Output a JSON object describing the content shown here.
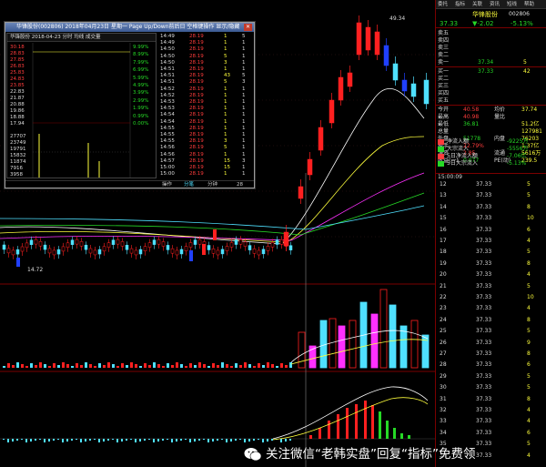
{
  "header": {
    "stock_name": "华锋股份",
    "stock_code": "002806",
    "top_menu": [
      "委托",
      "指标",
      "关联",
      "资讯",
      "短线",
      "帮助"
    ]
  },
  "quote": {
    "price": "37.33",
    "change": "▼-2.02",
    "change_pct": "-5.13%",
    "asks": [
      {
        "label": "卖五",
        "price": "",
        "vol": ""
      },
      {
        "label": "卖四",
        "price": "",
        "vol": ""
      },
      {
        "label": "卖三",
        "price": "",
        "vol": ""
      },
      {
        "label": "卖二",
        "price": "",
        "vol": ""
      },
      {
        "label": "卖一",
        "price": "37.34",
        "vol": "5"
      }
    ],
    "bids": [
      {
        "label": "买一",
        "price": "37.33",
        "vol": "42"
      },
      {
        "label": "买二",
        "price": "",
        "vol": ""
      },
      {
        "label": "买三",
        "price": "",
        "vol": ""
      },
      {
        "label": "买四",
        "price": "",
        "vol": ""
      },
      {
        "label": "买五",
        "price": "",
        "vol": ""
      }
    ],
    "stats": [
      {
        "l1": "今开",
        "v1": "40.58",
        "l2": "均价",
        "v2": "37.74"
      },
      {
        "l1": "最高",
        "v1": "40.98",
        "l2": "量比",
        "v2": ""
      },
      {
        "l1": "最低",
        "v1": "36.81",
        "l2": "",
        "v2": "51.2亿"
      },
      {
        "l1": "总量",
        "v1": "",
        "l2": "",
        "v2": "127981"
      },
      {
        "l1": "外盘",
        "v1": "51778",
        "l2": "内盘",
        "v2": "76203"
      },
      {
        "l1": "换手",
        "v1": "22.79%",
        "l2": "",
        "v2": "1.37亿"
      },
      {
        "l1": "净资",
        "v1": "2.85",
        "l2": "流通",
        "v2": "5616万"
      },
      {
        "l1": "收益(一)",
        "v1": "0.077",
        "l2": "PE(动)",
        "v2": "239.5"
      }
    ],
    "flows": [
      {
        "label": "净流入额",
        "value": "-9225万"
      },
      {
        "label": "大宗流入",
        "value": "-5556万"
      },
      {
        "label": "5日净流入额",
        "value": "-7.06亿"
      },
      {
        "label": "5日大宗流入",
        "value": "-5.13%"
      }
    ],
    "ticks_header": "15:00:09",
    "ticks": [
      {
        "t": "12",
        "p": "37.33",
        "v": "5"
      },
      {
        "t": "13",
        "p": "37.33",
        "v": "5"
      },
      {
        "t": "14",
        "p": "37.33",
        "v": "8"
      },
      {
        "t": "15",
        "p": "37.33",
        "v": "10"
      },
      {
        "t": "16",
        "p": "37.33",
        "v": "6"
      },
      {
        "t": "17",
        "p": "37.33",
        "v": "4"
      },
      {
        "t": "18",
        "p": "37.33",
        "v": "5"
      },
      {
        "t": "19",
        "p": "37.33",
        "v": "8"
      },
      {
        "t": "20",
        "p": "37.33",
        "v": "4"
      },
      {
        "t": "21",
        "p": "37.33",
        "v": "5"
      },
      {
        "t": "22",
        "p": "37.33",
        "v": "10"
      },
      {
        "t": "23",
        "p": "37.33",
        "v": "4"
      },
      {
        "t": "24",
        "p": "37.33",
        "v": "8"
      },
      {
        "t": "25",
        "p": "37.33",
        "v": "5"
      },
      {
        "t": "26",
        "p": "37.33",
        "v": "9"
      },
      {
        "t": "27",
        "p": "37.33",
        "v": "8"
      },
      {
        "t": "28",
        "p": "37.33",
        "v": "6"
      },
      {
        "t": "29",
        "p": "37.33",
        "v": "5"
      },
      {
        "t": "30",
        "p": "37.33",
        "v": "5"
      },
      {
        "t": "31",
        "p": "37.33",
        "v": "8"
      },
      {
        "t": "32",
        "p": "37.33",
        "v": "4"
      },
      {
        "t": "33",
        "p": "37.33",
        "v": "4"
      },
      {
        "t": "34",
        "p": "37.33",
        "v": "6"
      },
      {
        "t": "35",
        "p": "37.33",
        "v": "5"
      },
      {
        "t": "36",
        "p": "37.33",
        "v": "4"
      }
    ]
  },
  "popup": {
    "title": "华锋股份(002806)  2018年04月23日  星期一  Page Up/Down前后日  空格键操作  显示/隐藏",
    "inner_header": "华锋股份   2018-04-23 分时 均线 成交量",
    "price_labels": [
      "30.18",
      "28.83",
      "27.85",
      "26.83",
      "25.83",
      "24.83",
      "23.85",
      "22.83",
      "21.87",
      "20.88",
      "19.86",
      "18.88",
      "17.94"
    ],
    "vol_labels": [
      "27707",
      "23749",
      "19791",
      "15832",
      "11874",
      "7916",
      "3958"
    ],
    "pct_labels": [
      "9.99%",
      "8.99%",
      "7.99%",
      "6.99%",
      "5.99%",
      "4.99%",
      "3.99%",
      "2.99%",
      "1.99%",
      "0.99%",
      "0.00%"
    ],
    "trades": [
      {
        "time": "14:49",
        "price": "28.19",
        "vol": "1",
        "n": "5"
      },
      {
        "time": "14:49",
        "price": "28.19",
        "vol": "1",
        "n": "1"
      },
      {
        "time": "14:50",
        "price": "28.19",
        "vol": "1",
        "n": "1"
      },
      {
        "time": "14:50",
        "price": "28.19",
        "vol": "5",
        "n": "1"
      },
      {
        "time": "14:50",
        "price": "28.19",
        "vol": "3",
        "n": "1"
      },
      {
        "time": "14:51",
        "price": "28.19",
        "vol": "1",
        "n": "1"
      },
      {
        "time": "14:51",
        "price": "28.19",
        "vol": "43",
        "n": "5"
      },
      {
        "time": "14:51",
        "price": "28.19",
        "vol": "5",
        "n": "3"
      },
      {
        "time": "14:52",
        "price": "28.19",
        "vol": "1",
        "n": "1"
      },
      {
        "time": "14:52",
        "price": "28.19",
        "vol": "1",
        "n": "1"
      },
      {
        "time": "14:53",
        "price": "28.19",
        "vol": "1",
        "n": "1"
      },
      {
        "time": "14:53",
        "price": "28.19",
        "vol": "1",
        "n": "1"
      },
      {
        "time": "14:54",
        "price": "28.19",
        "vol": "1",
        "n": "1"
      },
      {
        "time": "14:54",
        "price": "28.19",
        "vol": "1",
        "n": "1"
      },
      {
        "time": "14:55",
        "price": "28.19",
        "vol": "1",
        "n": "1"
      },
      {
        "time": "14:55",
        "price": "28.19",
        "vol": "1",
        "n": "1"
      },
      {
        "time": "14:55",
        "price": "28.19",
        "vol": "3",
        "n": "1"
      },
      {
        "time": "14:56",
        "price": "28.19",
        "vol": "5",
        "n": "1"
      },
      {
        "time": "14:56",
        "price": "28.19",
        "vol": "1",
        "n": "1"
      },
      {
        "time": "14:57",
        "price": "28.19",
        "vol": "15",
        "n": "3"
      },
      {
        "time": "15:00",
        "price": "28.19",
        "vol": "15",
        "n": "1"
      },
      {
        "time": "15:00",
        "price": "28.19",
        "vol": "1",
        "n": "1"
      }
    ],
    "footer": [
      "操作",
      "分笔",
      "分钟",
      "28"
    ]
  },
  "main_chart": {
    "min_label": "14.72",
    "max_label": "49.34",
    "colors": {
      "up": "#ff2020",
      "down": "#2040ff",
      "cyan": "#4fe0ff",
      "magenta": "#ff30ff"
    }
  },
  "watermark": {
    "text": "关注微信“老韩实盘”回复“指标”免费领"
  }
}
